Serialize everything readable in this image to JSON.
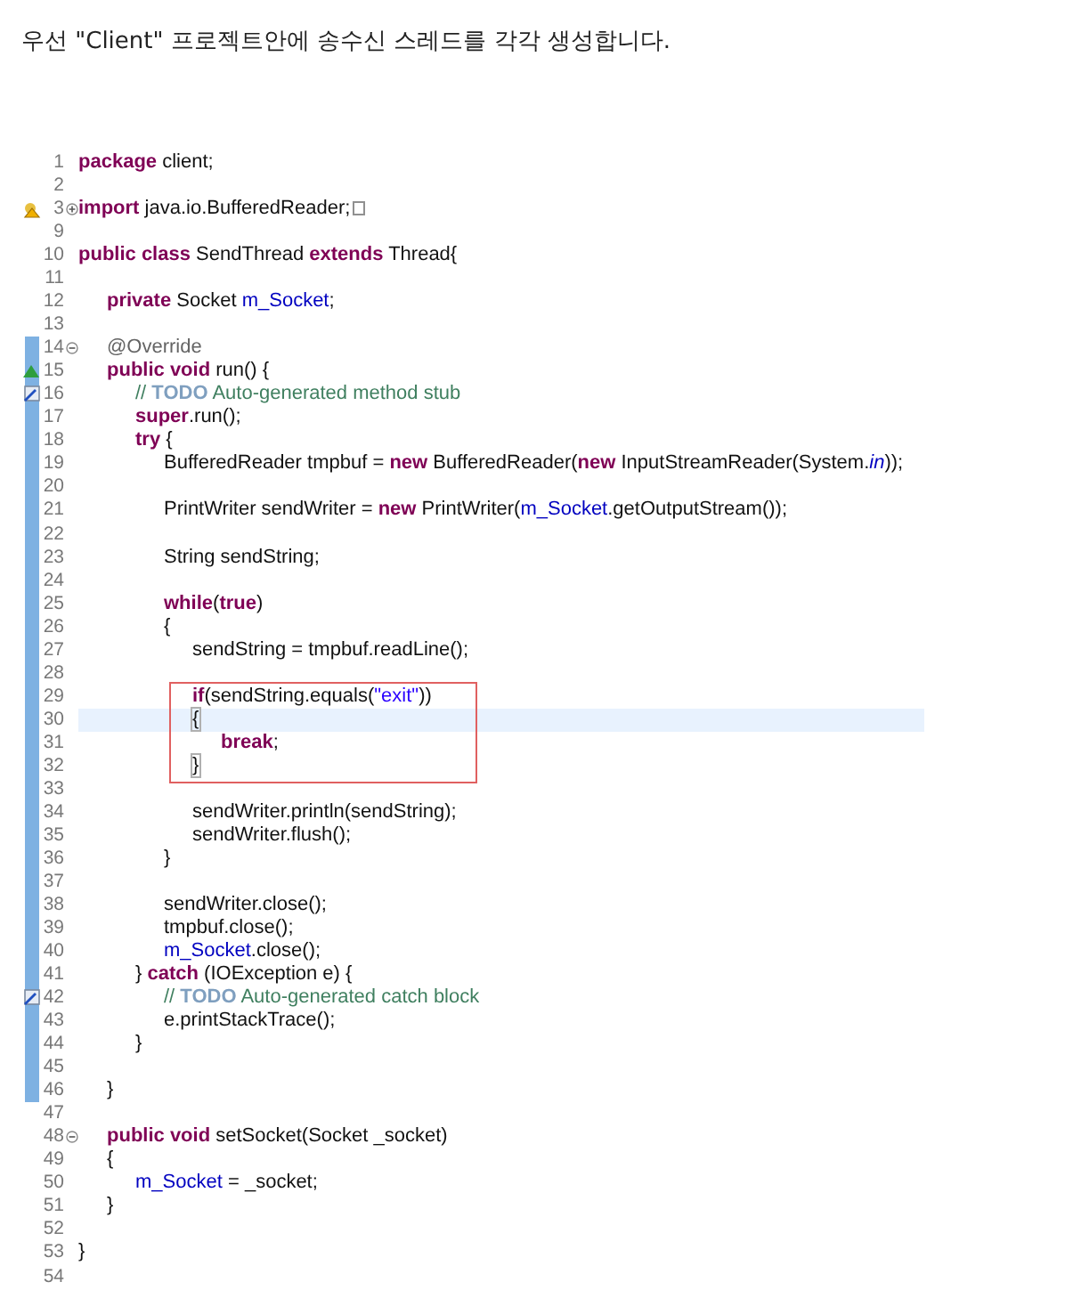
{
  "heading": "우선 \"Client\" 프로젝트안에 송수신 스레드를 각각 생성합니다.",
  "lines": [
    {
      "number": "1",
      "current": false,
      "boxed": false,
      "scope": false,
      "tokens": [
        {
          "kind": "keyword",
          "text": "package"
        },
        {
          "kind": "plain",
          "text": " client;"
        }
      ]
    },
    {
      "number": "2",
      "current": false,
      "boxed": false,
      "scope": false
    },
    {
      "number": "3",
      "current": false,
      "boxed": false,
      "scope": false,
      "gutter": {
        "kind": "warning"
      },
      "fold": {
        "kind": "expand"
      },
      "tokens": [
        {
          "kind": "keyword",
          "text": "import"
        },
        {
          "kind": "plain",
          "text": " java.io.BufferedReader;"
        }
      ]
    },
    {
      "number": "9",
      "current": false,
      "boxed": false,
      "scope": false
    },
    {
      "number": "10",
      "current": false,
      "boxed": false,
      "scope": false,
      "tokens": [
        {
          "kind": "keyword",
          "text": "public class"
        },
        {
          "kind": "plain",
          "text": " SendThread "
        },
        {
          "kind": "keyword",
          "text": "extends"
        },
        {
          "kind": "plain",
          "text": " Thread{"
        }
      ]
    },
    {
      "number": "11",
      "current": false,
      "boxed": false,
      "scope": false
    },
    {
      "number": "12",
      "current": false,
      "boxed": false,
      "scope": false,
      "tokens": [
        {
          "kind": "keyword",
          "text": "\tprivate"
        },
        {
          "kind": "plain",
          "text": " Socket "
        },
        {
          "kind": "field",
          "text": "m_Socket"
        },
        {
          "kind": "plain",
          "text": ";"
        }
      ]
    },
    {
      "number": "13",
      "current": false,
      "boxed": false,
      "scope": false
    },
    {
      "number": "14",
      "current": false,
      "boxed": false,
      "scope": true,
      "fold": {
        "kind": "collapse"
      },
      "tokens": [
        {
          "kind": "annotation",
          "text": "\t@Override"
        }
      ]
    },
    {
      "number": "15",
      "current": false,
      "boxed": false,
      "scope": true,
      "gutter": {
        "kind": "override"
      },
      "tokens": [
        {
          "kind": "keyword",
          "text": "\tpublic void"
        },
        {
          "kind": "plain",
          "text": " run() {"
        }
      ]
    },
    {
      "number": "16",
      "current": false,
      "boxed": false,
      "scope": true,
      "gutter": {
        "kind": "task"
      },
      "tokens": [
        {
          "kind": "comment",
          "text": "\t\t// "
        },
        {
          "kind": "todo",
          "text": "TODO"
        },
        {
          "kind": "comment",
          "text": " Auto-generated method stub"
        }
      ]
    },
    {
      "number": "17",
      "current": false,
      "boxed": false,
      "scope": true,
      "tokens": [
        {
          "kind": "keyword",
          "text": "\t\tsuper"
        },
        {
          "kind": "plain",
          "text": ".run();"
        }
      ]
    },
    {
      "number": "18",
      "current": false,
      "boxed": false,
      "scope": true,
      "tokens": [
        {
          "kind": "keyword",
          "text": "\t\ttry"
        },
        {
          "kind": "plain",
          "text": " {"
        }
      ]
    },
    {
      "number": "19",
      "current": false,
      "boxed": false,
      "scope": true,
      "tokens": [
        {
          "kind": "plain",
          "text": "\t\t\tBufferedReader tmpbuf = "
        },
        {
          "kind": "keyword",
          "text": "new"
        },
        {
          "kind": "plain",
          "text": " BufferedReader("
        },
        {
          "kind": "keyword",
          "text": "new"
        },
        {
          "kind": "plain",
          "text": " InputStreamReader(System."
        },
        {
          "kind": "static",
          "text": "in"
        },
        {
          "kind": "plain",
          "text": "));"
        }
      ]
    },
    {
      "number": "20",
      "current": false,
      "boxed": false,
      "scope": true
    },
    {
      "number": "21",
      "current": false,
      "boxed": false,
      "scope": true,
      "tokens": [
        {
          "kind": "plain",
          "text": "\t\t\tPrintWriter sendWriter = "
        },
        {
          "kind": "keyword",
          "text": "new"
        },
        {
          "kind": "plain",
          "text": " PrintWriter("
        },
        {
          "kind": "field",
          "text": "m_Socket"
        },
        {
          "kind": "plain",
          "text": ".getOutputStream());"
        }
      ]
    },
    {
      "number": "22",
      "current": false,
      "boxed": false,
      "scope": true
    },
    {
      "number": "23",
      "current": false,
      "boxed": false,
      "scope": true,
      "tokens": [
        {
          "kind": "plain",
          "text": "\t\t\tString sendString;"
        }
      ]
    },
    {
      "number": "24",
      "current": false,
      "boxed": false,
      "scope": true
    },
    {
      "number": "25",
      "current": false,
      "boxed": false,
      "scope": true,
      "tokens": [
        {
          "kind": "keyword",
          "text": "\t\t\twhile"
        },
        {
          "kind": "plain",
          "text": "("
        },
        {
          "kind": "keyword",
          "text": "true"
        },
        {
          "kind": "plain",
          "text": ")"
        }
      ]
    },
    {
      "number": "26",
      "current": false,
      "boxed": false,
      "scope": true,
      "tokens": [
        {
          "kind": "plain",
          "text": "\t\t\t{"
        }
      ]
    },
    {
      "number": "27",
      "current": false,
      "boxed": false,
      "scope": true,
      "tokens": [
        {
          "kind": "plain",
          "text": "\t\t\t\tsendString = tmpbuf.readLine();"
        }
      ]
    },
    {
      "number": "28",
      "current": false,
      "boxed": false,
      "scope": true
    },
    {
      "number": "29",
      "current": false,
      "boxed": true,
      "scope": true,
      "tokens": [
        {
          "kind": "keyword",
          "text": "\t\t\t\tif"
        },
        {
          "kind": "plain",
          "text": "(sendString.equals("
        },
        {
          "kind": "string",
          "text": "\"exit\""
        },
        {
          "kind": "plain",
          "text": "))"
        }
      ]
    },
    {
      "number": "30",
      "current": true,
      "boxed": true,
      "scope": true,
      "tokens": [
        {
          "kind": "match",
          "text": "\t\t\t\t{"
        }
      ]
    },
    {
      "number": "31",
      "current": false,
      "boxed": true,
      "scope": true,
      "tokens": [
        {
          "kind": "keyword",
          "text": "\t\t\t\t\tbreak"
        },
        {
          "kind": "plain",
          "text": ";"
        }
      ]
    },
    {
      "number": "32",
      "current": false,
      "boxed": true,
      "scope": true,
      "tokens": [
        {
          "kind": "match",
          "text": "\t\t\t\t}"
        }
      ]
    },
    {
      "number": "33",
      "current": false,
      "boxed": false,
      "scope": true
    },
    {
      "number": "34",
      "current": false,
      "boxed": false,
      "scope": true,
      "tokens": [
        {
          "kind": "plain",
          "text": "\t\t\t\tsendWriter.println(sendString);"
        }
      ]
    },
    {
      "number": "35",
      "current": false,
      "boxed": false,
      "scope": true,
      "tokens": [
        {
          "kind": "plain",
          "text": "\t\t\t\tsendWriter.flush();"
        }
      ]
    },
    {
      "number": "36",
      "current": false,
      "boxed": false,
      "scope": true,
      "tokens": [
        {
          "kind": "plain",
          "text": "\t\t\t}"
        }
      ]
    },
    {
      "number": "37",
      "current": false,
      "boxed": false,
      "scope": true
    },
    {
      "number": "38",
      "current": false,
      "boxed": false,
      "scope": true,
      "tokens": [
        {
          "kind": "plain",
          "text": "\t\t\tsendWriter.close();"
        }
      ]
    },
    {
      "number": "39",
      "current": false,
      "boxed": false,
      "scope": true,
      "tokens": [
        {
          "kind": "plain",
          "text": "\t\t\ttmpbuf.close();"
        }
      ]
    },
    {
      "number": "40",
      "current": false,
      "boxed": false,
      "scope": true,
      "tokens": [
        {
          "kind": "field",
          "text": "\t\t\tm_Socket"
        },
        {
          "kind": "plain",
          "text": ".close();"
        }
      ]
    },
    {
      "number": "41",
      "current": false,
      "boxed": false,
      "scope": true,
      "tokens": [
        {
          "kind": "plain",
          "text": "\t\t} "
        },
        {
          "kind": "keyword",
          "text": "catch"
        },
        {
          "kind": "plain",
          "text": " (IOException e) {"
        }
      ]
    },
    {
      "number": "42",
      "current": false,
      "boxed": false,
      "scope": true,
      "gutter": {
        "kind": "task"
      },
      "tokens": [
        {
          "kind": "comment",
          "text": "\t\t\t// "
        },
        {
          "kind": "todo",
          "text": "TODO"
        },
        {
          "kind": "comment",
          "text": " Auto-generated catch block"
        }
      ]
    },
    {
      "number": "43",
      "current": false,
      "boxed": false,
      "scope": true,
      "tokens": [
        {
          "kind": "plain",
          "text": "\t\t\te.printStackTrace();"
        }
      ]
    },
    {
      "number": "44",
      "current": false,
      "boxed": false,
      "scope": true,
      "tokens": [
        {
          "kind": "plain",
          "text": "\t\t}"
        }
      ]
    },
    {
      "number": "45",
      "current": false,
      "boxed": false,
      "scope": true
    },
    {
      "number": "46",
      "current": false,
      "boxed": false,
      "scope": true,
      "tokens": [
        {
          "kind": "plain",
          "text": "\t}"
        }
      ]
    },
    {
      "number": "47",
      "current": false,
      "boxed": false,
      "scope": false
    },
    {
      "number": "48",
      "current": false,
      "boxed": false,
      "scope": false,
      "fold": {
        "kind": "collapse"
      },
      "tokens": [
        {
          "kind": "keyword",
          "text": "\tpublic void"
        },
        {
          "kind": "plain",
          "text": " setSocket(Socket _socket)"
        }
      ]
    },
    {
      "number": "49",
      "current": false,
      "boxed": false,
      "scope": false,
      "tokens": [
        {
          "kind": "plain",
          "text": "\t{"
        }
      ]
    },
    {
      "number": "50",
      "current": false,
      "boxed": false,
      "scope": false,
      "tokens": [
        {
          "kind": "field",
          "text": "\t\tm_Socket"
        },
        {
          "kind": "plain",
          "text": " = _socket;"
        }
      ]
    },
    {
      "number": "51",
      "current": false,
      "boxed": false,
      "scope": false,
      "tokens": [
        {
          "kind": "plain",
          "text": "\t}"
        }
      ]
    },
    {
      "number": "52",
      "current": false,
      "boxed": false,
      "scope": false
    },
    {
      "number": "53",
      "current": false,
      "boxed": false,
      "scope": false,
      "tokens": [
        {
          "kind": "plain",
          "text": "}"
        }
      ]
    },
    {
      "number": "54",
      "current": false,
      "boxed": false,
      "scope": false
    }
  ]
}
